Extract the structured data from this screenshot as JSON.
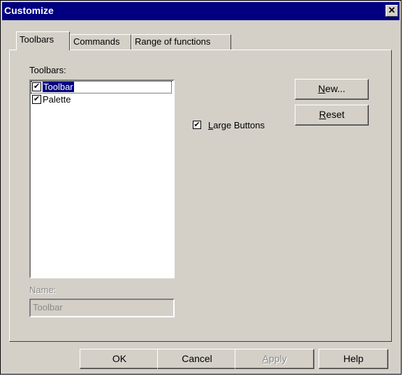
{
  "window": {
    "title": "Customize",
    "close_glyph": "✕"
  },
  "tabs": [
    "Toolbars",
    "Commands",
    "Range of functions"
  ],
  "toolbars_section": {
    "label": "Toolbars:",
    "items": [
      {
        "label": "Toolbar",
        "checked": true,
        "selected": true
      },
      {
        "label": "Palette",
        "checked": true,
        "selected": false
      }
    ]
  },
  "buttons": {
    "new_prefix": "N",
    "new_rest": "ew...",
    "reset_prefix": "R",
    "reset_rest": "eset"
  },
  "large_buttons": {
    "prefix": "L",
    "rest": "arge Buttons",
    "checked": true
  },
  "name_field": {
    "label": "Name:",
    "value": "Toolbar"
  },
  "footer": {
    "ok": "OK",
    "cancel": "Cancel",
    "apply_prefix": "A",
    "apply_rest": "pply",
    "help": "Help"
  },
  "check_glyph": "✔"
}
